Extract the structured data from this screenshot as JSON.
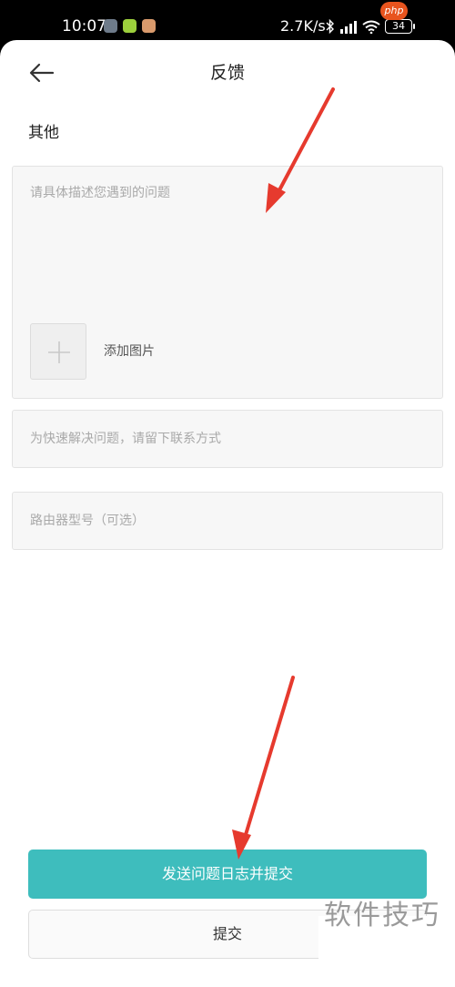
{
  "status_bar": {
    "time": "10:07",
    "network_speed": "2.7K/s",
    "battery": "34",
    "icons": [
      "bluetooth-icon",
      "signal-icon",
      "wifi-icon",
      "battery-icon"
    ]
  },
  "watermarks": {
    "top": "php",
    "bottom": "软件技巧"
  },
  "header": {
    "title": "反馈",
    "back_icon": "back-arrow-icon"
  },
  "form": {
    "section_title": "其他",
    "description_placeholder": "请具体描述您遇到的问题",
    "add_image_label": "添加图片",
    "contact_placeholder": "为快速解决问题，请留下联系方式",
    "router_model_placeholder": "路由器型号（可选）"
  },
  "actions": {
    "send_log_label": "发送问题日志并提交",
    "submit_label": "提交"
  },
  "colors": {
    "accent": "#3ebdbd",
    "annotation_arrow": "#e63a2e",
    "placeholder": "#a9a9a9"
  }
}
